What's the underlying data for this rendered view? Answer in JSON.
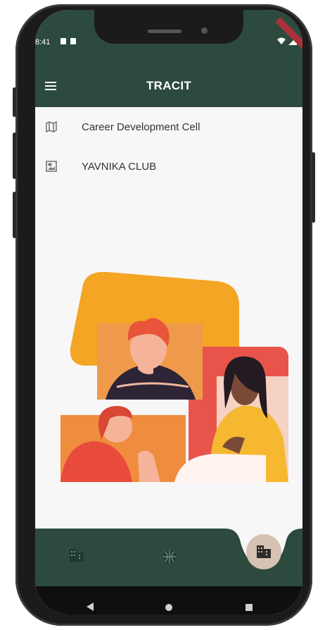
{
  "status_bar": {
    "time": "8:41"
  },
  "app_bar": {
    "title": "TRACIT",
    "menu_icon": "menu-icon"
  },
  "list": {
    "items": [
      {
        "label": "Career Development Cell",
        "icon": "map-icon"
      },
      {
        "label": "YAVNIKA CLUB",
        "icon": "image-icon"
      }
    ]
  },
  "bottom_nav": {
    "items": [
      {
        "icon": "building-icon"
      },
      {
        "icon": "sports-basketball-icon"
      },
      {
        "icon": "building-icon",
        "selected": true
      }
    ]
  },
  "system_nav": {
    "items": [
      "back-icon",
      "home-icon",
      "recents-icon"
    ]
  },
  "colors": {
    "primary": "#2c4a3e",
    "fab": "#d6c2b2",
    "background": "#f7f7f7"
  }
}
